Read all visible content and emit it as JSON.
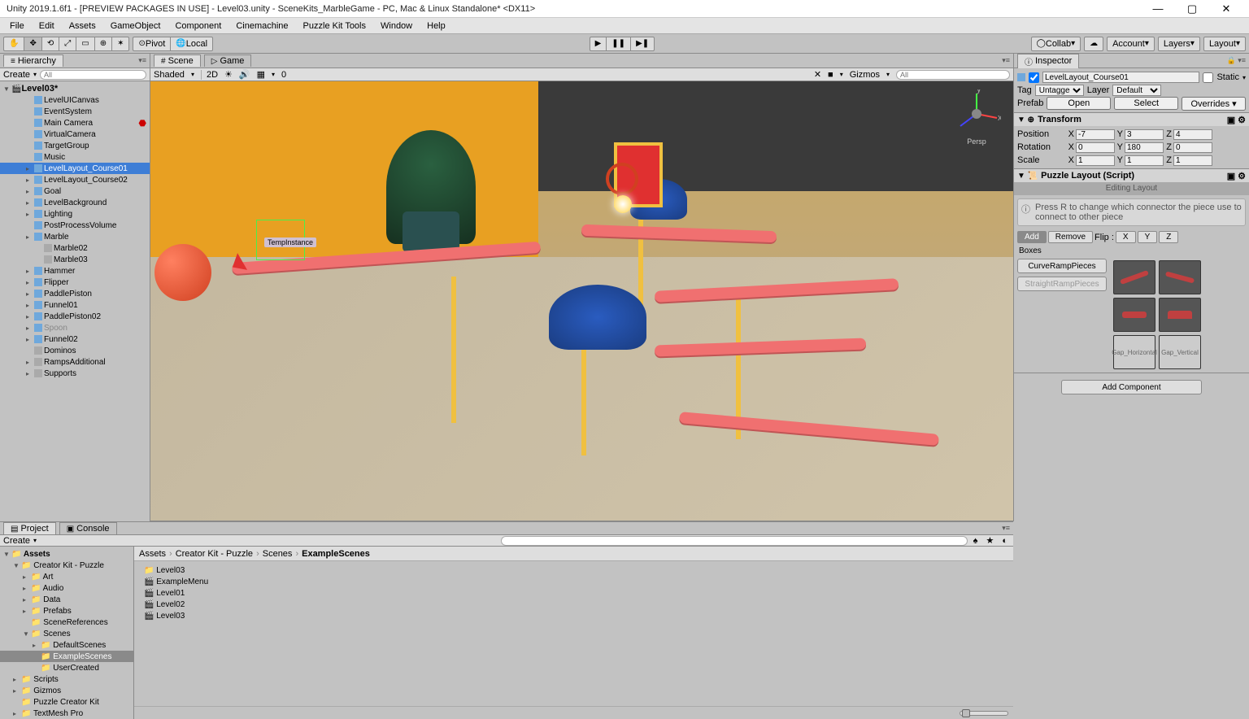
{
  "window": {
    "title": "Unity 2019.1.6f1 - [PREVIEW PACKAGES IN USE] - Level03.unity - SceneKits_MarbleGame - PC, Mac & Linux Standalone* <DX11>"
  },
  "menu": [
    "File",
    "Edit",
    "Assets",
    "GameObject",
    "Component",
    "Cinemachine",
    "Puzzle Kit Tools",
    "Window",
    "Help"
  ],
  "toolbar": {
    "pivot": "Pivot",
    "local": "Local",
    "collab": "Collab",
    "account": "Account",
    "layers": "Layers",
    "layout": "Layout"
  },
  "hierarchy": {
    "tab": "Hierarchy",
    "create": "Create",
    "search_ph": "All",
    "scene": "Level03*",
    "items": [
      {
        "name": "LevelUICanvas",
        "cube": "blue",
        "ind": 2
      },
      {
        "name": "EventSystem",
        "cube": "blue",
        "ind": 2
      },
      {
        "name": "Main Camera",
        "cube": "blue",
        "ind": 2,
        "red": true
      },
      {
        "name": "VirtualCamera",
        "cube": "blue",
        "ind": 2
      },
      {
        "name": "TargetGroup",
        "cube": "blue",
        "ind": 2
      },
      {
        "name": "Music",
        "cube": "blue",
        "ind": 2
      },
      {
        "name": "LevelLayout_Course01",
        "cube": "blue",
        "ind": 2,
        "sel": true,
        "arrow": true
      },
      {
        "name": "LevelLayout_Course02",
        "cube": "blue",
        "ind": 2,
        "arrow": true
      },
      {
        "name": "Goal",
        "cube": "blue",
        "ind": 2,
        "arrow": true
      },
      {
        "name": "LevelBackground",
        "cube": "blue",
        "ind": 2,
        "arrow": true
      },
      {
        "name": "Lighting",
        "cube": "blue",
        "ind": 2,
        "arrow": true
      },
      {
        "name": "PostProcessVolume",
        "cube": "blue",
        "ind": 2
      },
      {
        "name": "Marble",
        "cube": "blue",
        "ind": 2,
        "arrow": true
      },
      {
        "name": "Marble02",
        "cube": "grey",
        "ind": 3
      },
      {
        "name": "Marble03",
        "cube": "grey",
        "ind": 3
      },
      {
        "name": "Hammer",
        "cube": "blue",
        "ind": 2,
        "arrow": true
      },
      {
        "name": "Flipper",
        "cube": "blue",
        "ind": 2,
        "arrow": true
      },
      {
        "name": "PaddlePiston",
        "cube": "blue",
        "ind": 2,
        "arrow": true
      },
      {
        "name": "Funnel01",
        "cube": "blue",
        "ind": 2,
        "arrow": true
      },
      {
        "name": "PaddlePiston02",
        "cube": "blue",
        "ind": 2,
        "arrow": true
      },
      {
        "name": "Spoon",
        "cube": "blue",
        "ind": 2,
        "arrow": true,
        "dim": true
      },
      {
        "name": "Funnel02",
        "cube": "blue",
        "ind": 2,
        "arrow": true
      },
      {
        "name": "Dominos",
        "cube": "grey",
        "ind": 2
      },
      {
        "name": "RampsAdditional",
        "cube": "grey",
        "ind": 2,
        "arrow": true
      },
      {
        "name": "Supports",
        "cube": "grey",
        "ind": 2,
        "arrow": true
      }
    ]
  },
  "scene": {
    "tab_scene": "Scene",
    "tab_game": "Game",
    "shading": "Shaded",
    "twod": "2D",
    "gizmos": "Gizmos",
    "persp": "Persp",
    "zero": "0",
    "temp_label": "TempInstance"
  },
  "project": {
    "tab_project": "Project",
    "tab_console": "Console",
    "create": "Create",
    "breadcrumb": [
      "Assets",
      "Creator Kit - Puzzle",
      "Scenes",
      "ExampleScenes"
    ],
    "tree": [
      {
        "name": "Assets",
        "ind": 0,
        "arrow": "down",
        "bold": true
      },
      {
        "name": "Creator Kit - Puzzle",
        "ind": 1,
        "arrow": "down"
      },
      {
        "name": "Art",
        "ind": 2,
        "arrow": "right"
      },
      {
        "name": "Audio",
        "ind": 2,
        "arrow": "right"
      },
      {
        "name": "Data",
        "ind": 2,
        "arrow": "right"
      },
      {
        "name": "Prefabs",
        "ind": 2,
        "arrow": "right"
      },
      {
        "name": "SceneReferences",
        "ind": 2
      },
      {
        "name": "Scenes",
        "ind": 2,
        "arrow": "down"
      },
      {
        "name": "DefaultScenes",
        "ind": 3,
        "arrow": "right"
      },
      {
        "name": "ExampleScenes",
        "ind": 3,
        "sel": true
      },
      {
        "name": "UserCreated",
        "ind": 3
      },
      {
        "name": "Scripts",
        "ind": 1,
        "arrow": "right"
      },
      {
        "name": "Gizmos",
        "ind": 1,
        "arrow": "right"
      },
      {
        "name": "Puzzle Creator Kit",
        "ind": 1
      },
      {
        "name": "TextMesh Pro",
        "ind": 1,
        "arrow": "right"
      }
    ],
    "items": [
      "Level03",
      "ExampleMenu",
      "Level01",
      "Level02",
      "Level03"
    ]
  },
  "inspector": {
    "tab": "Inspector",
    "obj_name": "LevelLayout_Course01",
    "static": "Static",
    "tag_lbl": "Tag",
    "tag_val": "Untagged",
    "layer_lbl": "Layer",
    "layer_val": "Default",
    "prefab_lbl": "Prefab",
    "open": "Open",
    "select": "Select",
    "overrides": "Overrides",
    "transform": {
      "title": "Transform",
      "pos_lbl": "Position",
      "px": "-7",
      "py": "3",
      "pz": "4",
      "rot_lbl": "Rotation",
      "rx": "0",
      "ry": "180",
      "rz": "0",
      "scl_lbl": "Scale",
      "sx": "1",
      "sy": "1",
      "sz": "1"
    },
    "puzzle": {
      "title": "Puzzle Layout (Script)",
      "edit_mode": "Editing Layout",
      "hint": "Press R to change which connector the piece use to connect to other piece",
      "add": "Add",
      "remove": "Remove",
      "flip": "Flip :",
      "x": "X",
      "y": "Y",
      "z": "Z",
      "boxes": "Boxes",
      "curve": "CurveRampPieces",
      "straight": "StraightRampPieces",
      "gap_h": "Gap_Horizontal",
      "gap_v": "Gap_Vertical"
    },
    "add_component": "Add Component"
  }
}
